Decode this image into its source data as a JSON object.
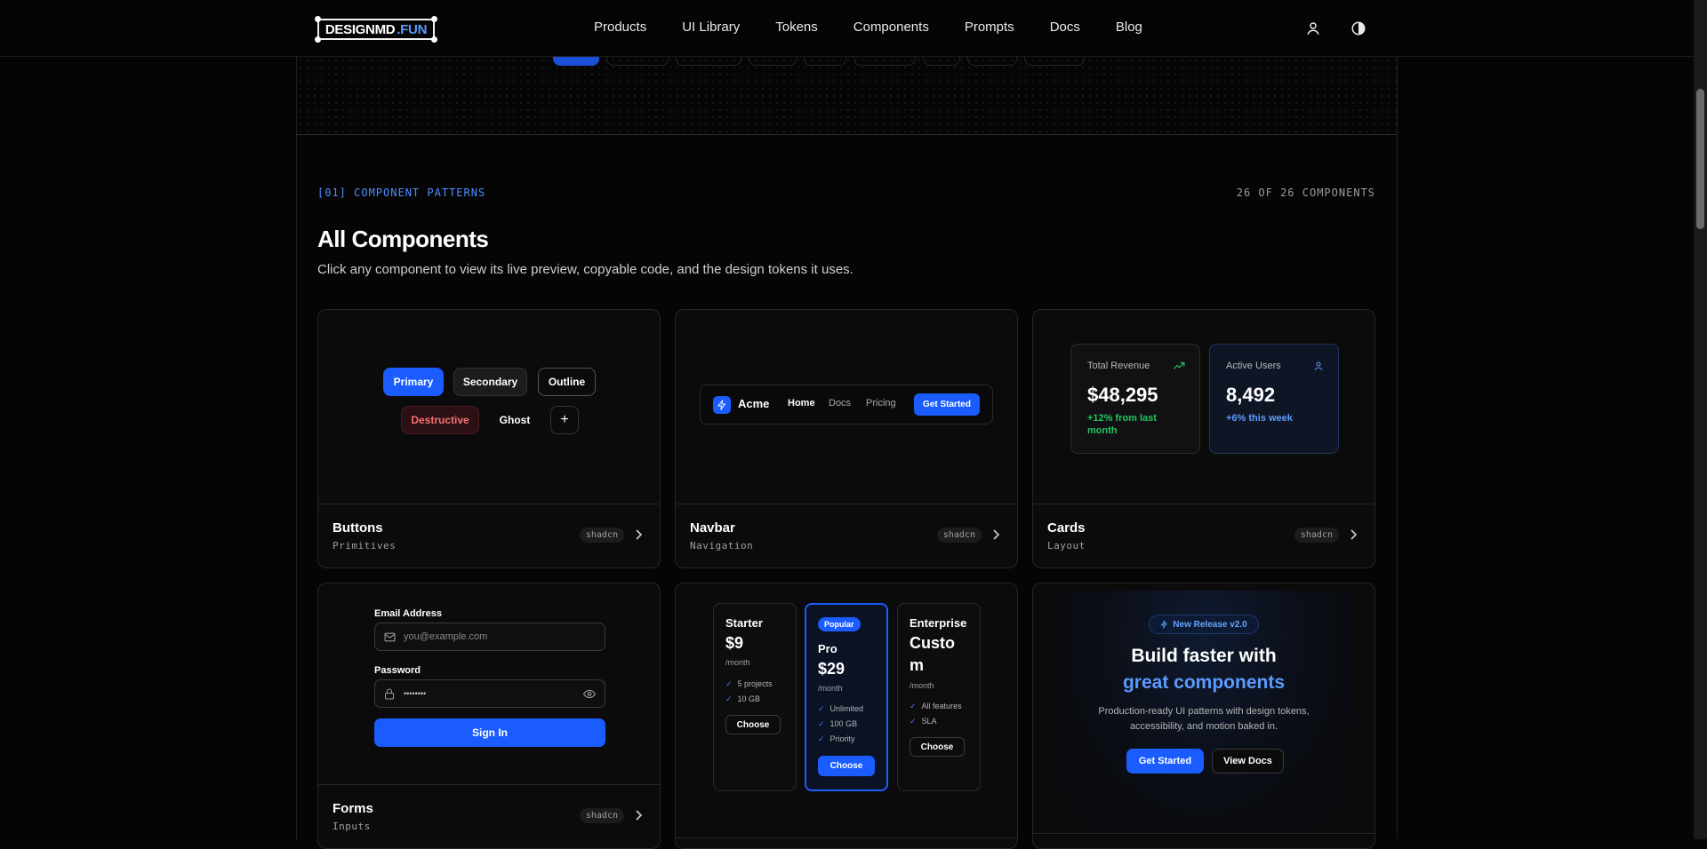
{
  "nav": {
    "logo_main": "DESIGNMD",
    "logo_accent": ".FUN",
    "links": [
      "Products",
      "UI Library",
      "Tokens",
      "Components",
      "Prompts",
      "Docs",
      "Blog"
    ]
  },
  "section": {
    "label": "[01] COMPONENT PATTERNS",
    "count": "26 OF 26 COMPONENTS",
    "title": "All Components",
    "subtitle": "Click any component to view its live preview, copyable code, and the design tokens it uses."
  },
  "cards": {
    "buttons": {
      "name": "Buttons",
      "category": "Primitives",
      "tag": "shadcn",
      "labels": {
        "primary": "Primary",
        "secondary": "Secondary",
        "outline": "Outline",
        "destructive": "Destructive",
        "ghost": "Ghost",
        "icon": "+"
      }
    },
    "navbar": {
      "name": "Navbar",
      "category": "Navigation",
      "tag": "shadcn",
      "brand": "Acme",
      "links": [
        "Home",
        "Docs",
        "Pricing"
      ],
      "cta": "Get Started"
    },
    "cards": {
      "name": "Cards",
      "category": "Layout",
      "tag": "shadcn",
      "stats": [
        {
          "label": "Total Revenue",
          "value": "$48,295",
          "delta": "+12% from last month"
        },
        {
          "label": "Active Users",
          "value": "8,492",
          "delta": "+6% this week"
        }
      ]
    },
    "forms": {
      "name": "Forms",
      "category": "Inputs",
      "tag": "shadcn",
      "email_label": "Email Address",
      "email_placeholder": "you@example.com",
      "password_label": "Password",
      "password_value": "••••••••",
      "submit": "Sign In"
    },
    "pricing": {
      "plans": [
        {
          "name": "Starter",
          "price": "$9",
          "period": "/month",
          "features": [
            "5 projects",
            "10 GB"
          ],
          "cta": "Choose"
        },
        {
          "badge": "Popular",
          "name": "Pro",
          "price": "$29",
          "period": "/month",
          "features": [
            "Unlimited",
            "100 GB",
            "Priority"
          ],
          "cta": "Choose"
        },
        {
          "name": "Enterprise",
          "price_line1": "Custo",
          "price_line2": "m",
          "period": "/month",
          "features": [
            "All features",
            "SLA"
          ],
          "cta": "Choose"
        }
      ]
    },
    "hero": {
      "badge": "New Release v2.0",
      "title_line1": "Build faster with",
      "title_line2": "great components",
      "desc_line1": "Production-ready UI patterns with design tokens,",
      "desc_line2": "accessibility, and motion baked in.",
      "primary_cta": "Get Started",
      "secondary_cta": "View Docs"
    }
  },
  "colors": {
    "accent": "#1b5cff",
    "accent_text": "#4d8dff",
    "success": "#22c55e",
    "destructive": "#f87171",
    "background": "#050505"
  },
  "icons": [
    "user-icon",
    "contrast-icon",
    "chevron-right-icon",
    "bolt-icon",
    "trend-up-icon",
    "mail-icon",
    "lock-icon",
    "eye-icon",
    "check-icon"
  ]
}
